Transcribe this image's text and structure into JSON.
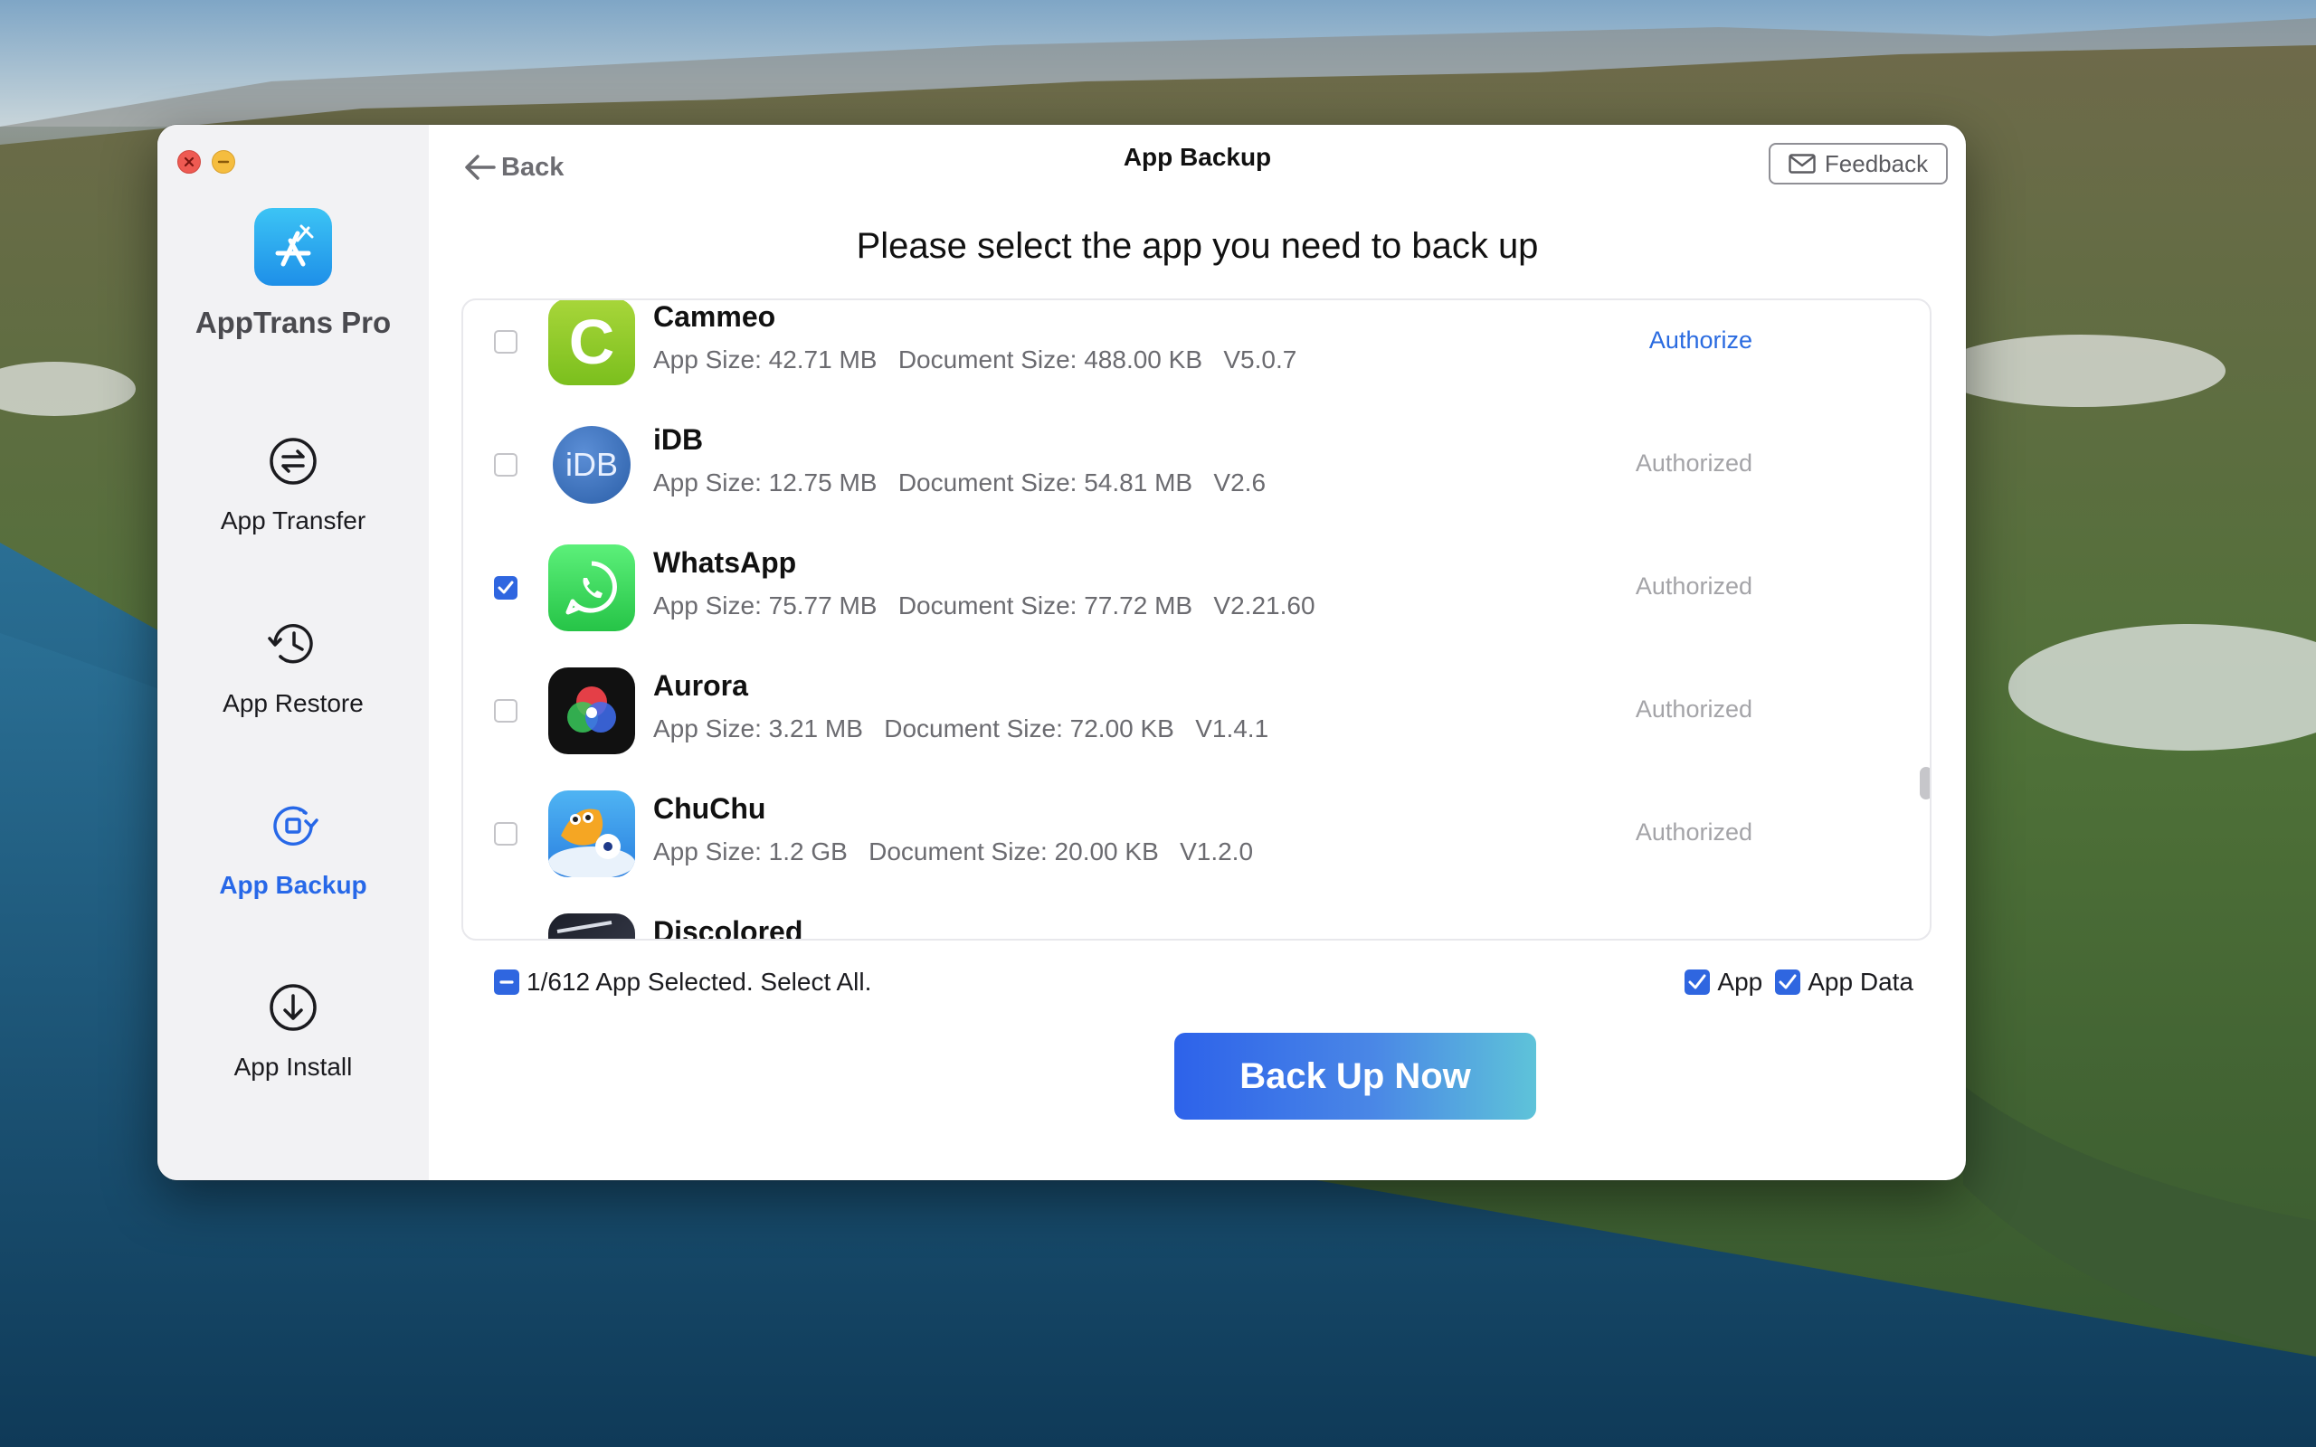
{
  "window": {
    "controls": [
      "close-button",
      "minimize-button"
    ]
  },
  "sidebar": {
    "app_name": "AppTrans Pro",
    "items": [
      {
        "label": "App Transfer",
        "icon": "transfer-icon",
        "active": false
      },
      {
        "label": "App Restore",
        "icon": "restore-icon",
        "active": false
      },
      {
        "label": "App Backup",
        "icon": "backup-icon",
        "active": true
      },
      {
        "label": "App Install",
        "icon": "install-icon",
        "active": false
      }
    ]
  },
  "header": {
    "back_label": "Back",
    "title": "App Backup",
    "feedback_label": "Feedback",
    "subtitle": "Please select the app you need to back up"
  },
  "apps": [
    {
      "name": "Cammeo",
      "details": "App Size: 42.71 MB   Document Size: 488.00 KB   V5.0.7",
      "status": "Authorize",
      "checked": false,
      "icon": "cammeo-icon"
    },
    {
      "name": "iDB",
      "details": "App Size: 12.75 MB   Document Size: 54.81 MB   V2.6",
      "status": "Authorized",
      "checked": false,
      "icon": "idb-icon",
      "icon_text": "iDB"
    },
    {
      "name": "WhatsApp",
      "details": "App Size: 75.77 MB   Document Size: 77.72 MB   V2.21.60",
      "status": "Authorized",
      "checked": true,
      "icon": "whatsapp-icon"
    },
    {
      "name": "Aurora",
      "details": "App Size: 3.21 MB   Document Size: 72.00 KB   V1.4.1",
      "status": "Authorized",
      "checked": false,
      "icon": "aurora-icon"
    },
    {
      "name": "ChuChu",
      "details": "App Size: 1.2 GB   Document Size: 20.00 KB   V1.2.0",
      "status": "Authorized",
      "checked": false,
      "icon": "chuchu-icon"
    },
    {
      "name": "Discolored",
      "details": "",
      "status": "",
      "checked": false,
      "icon": "discolored-icon"
    }
  ],
  "footer": {
    "selection_text": "1/612 App Selected. Select All.",
    "option_app": "App",
    "option_app_data": "App Data",
    "backup_button": "Back Up Now"
  },
  "colors": {
    "accent": "#2768e8",
    "link": "#2a6be0",
    "authorized": "#a4a4a8"
  }
}
